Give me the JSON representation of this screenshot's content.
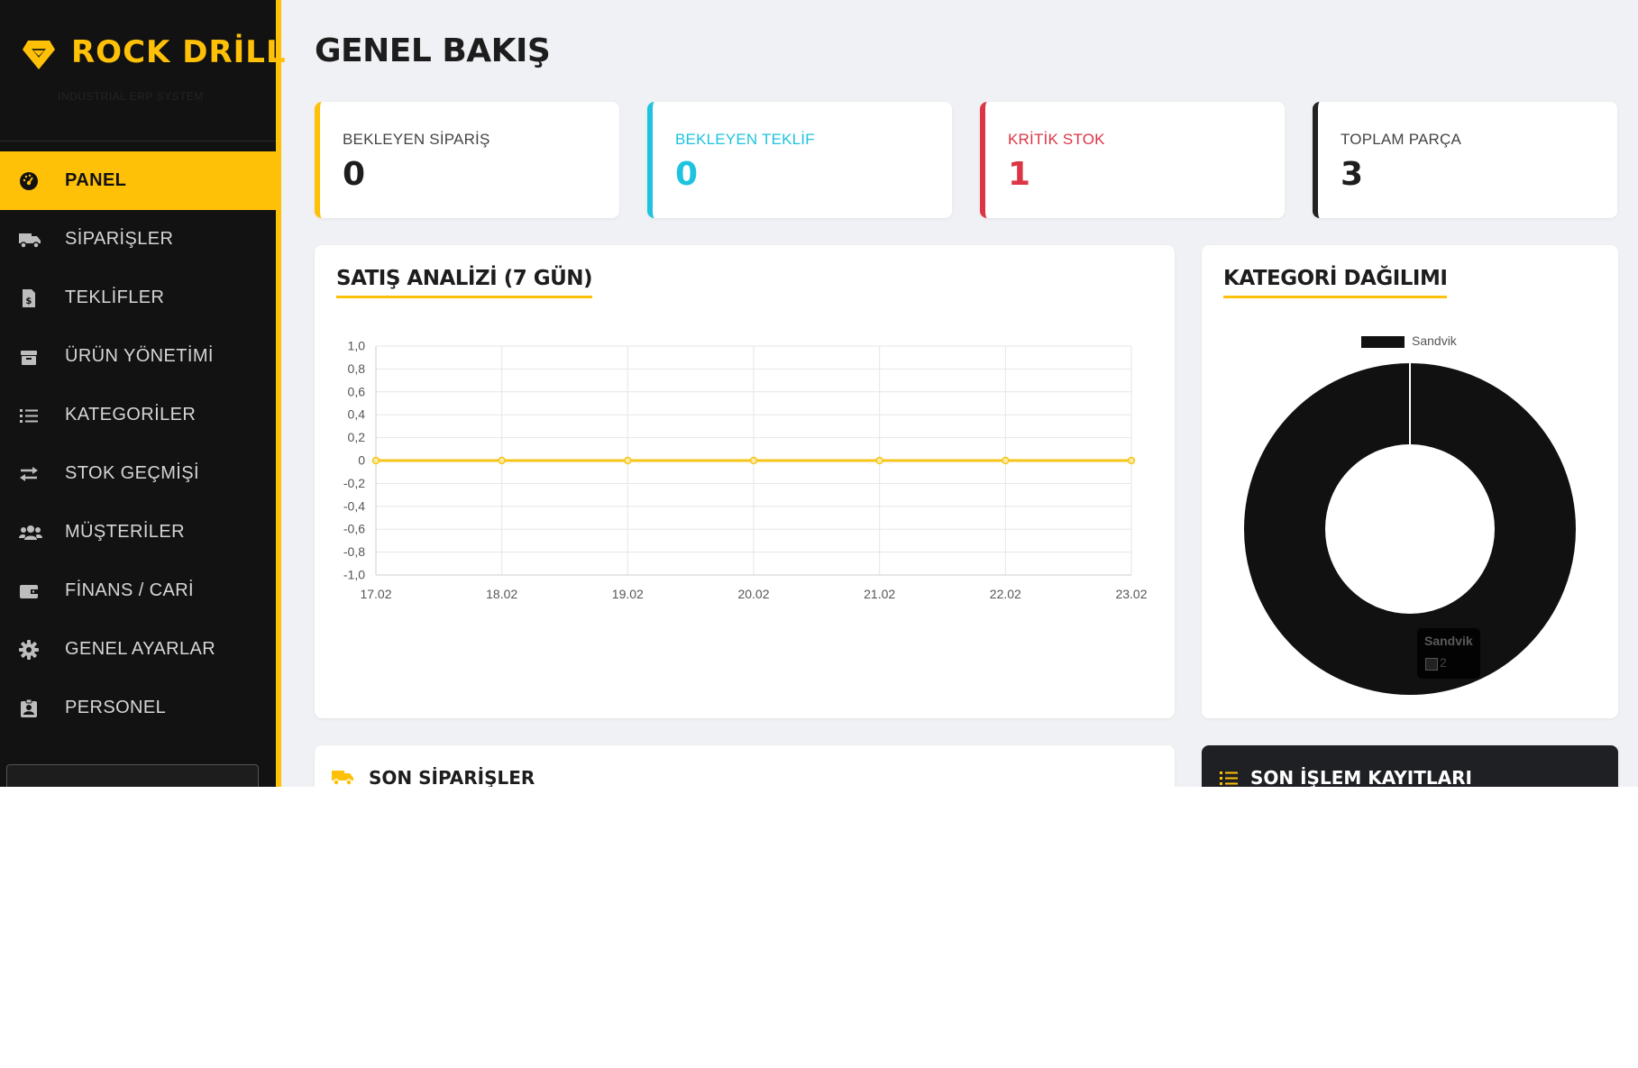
{
  "brand": {
    "name": "ROCK DRİLL",
    "subtitle": "INDUSTRIAL ERP SYSTEM"
  },
  "nav": {
    "items": [
      {
        "label": "PANEL",
        "icon": "dashboard-gauge-icon",
        "active": true
      },
      {
        "label": "SİPARİŞLER",
        "icon": "truck-icon"
      },
      {
        "label": "TEKLİFLER",
        "icon": "invoice-dollar-icon"
      },
      {
        "label": "ÜRÜN YÖNETİMİ",
        "icon": "box-icon"
      },
      {
        "label": "KATEGORİLER",
        "icon": "list-icon"
      },
      {
        "label": "STOK GEÇMİŞİ",
        "icon": "exchange-arrows-icon"
      },
      {
        "label": "MÜŞTERİLER",
        "icon": "users-icon"
      },
      {
        "label": "FİNANS / CARİ",
        "icon": "wallet-icon"
      },
      {
        "label": "GENEL AYARLAR",
        "icon": "gear-icon"
      },
      {
        "label": "PERSONEL",
        "icon": "id-badge-icon"
      }
    ]
  },
  "page": {
    "title": "GENEL BAKIŞ"
  },
  "stats": [
    {
      "label": "BEKLEYEN SİPARİŞ",
      "value": "0",
      "color": "#ffc107",
      "text_color": "#444444",
      "value_color": "#1d1d1d"
    },
    {
      "label": "BEKLEYEN TEKLİF",
      "value": "0",
      "color": "#1ec3e0",
      "text_color": "#1ec3e0",
      "value_color": "#1ec3e0"
    },
    {
      "label": "KRİTİK STOK",
      "value": "1",
      "color": "#dc3545",
      "text_color": "#dc3545",
      "value_color": "#dc3545"
    },
    {
      "label": "TOPLAM PARÇA",
      "value": "3",
      "color": "#222222",
      "text_color": "#444444",
      "value_color": "#1d1d1d"
    }
  ],
  "sales_card": {
    "title": "SATIŞ ANALİZİ (7 GÜN)"
  },
  "category_card": {
    "title": "KATEGORİ DAĞILIMI"
  },
  "chart_data": [
    {
      "type": "line",
      "title": "",
      "categories": [
        "17.02",
        "18.02",
        "19.02",
        "20.02",
        "21.02",
        "22.02",
        "23.02"
      ],
      "series": [
        {
          "values": [
            0,
            0,
            0,
            0,
            0,
            0,
            0
          ],
          "color": "#f5c518"
        }
      ],
      "ylim": [
        -1.0,
        1.0
      ],
      "yticks": [
        "1,0",
        "0,8",
        "0,6",
        "0,4",
        "0,2",
        "0",
        "-0,2",
        "-0,4",
        "-0,6",
        "-0,8",
        "-1,0"
      ],
      "grid": true
    },
    {
      "type": "pie",
      "variant": "doughnut",
      "labels": [
        "Sandvik"
      ],
      "values": [
        2
      ],
      "colors": [
        "#111111"
      ],
      "legend": "top",
      "tooltip": {
        "title": "Sandvik",
        "value": "2"
      }
    }
  ],
  "bottom": {
    "orders_title": "SON SİPARİŞLER",
    "orders_icon": "truck-icon",
    "logs_title": "SON İŞLEM KAYITLARI",
    "logs_icon": "list-icon"
  },
  "colors": {
    "accent": "#ffc107",
    "sidebar_bg": "#121212",
    "page_bg": "#f0f1f4"
  }
}
